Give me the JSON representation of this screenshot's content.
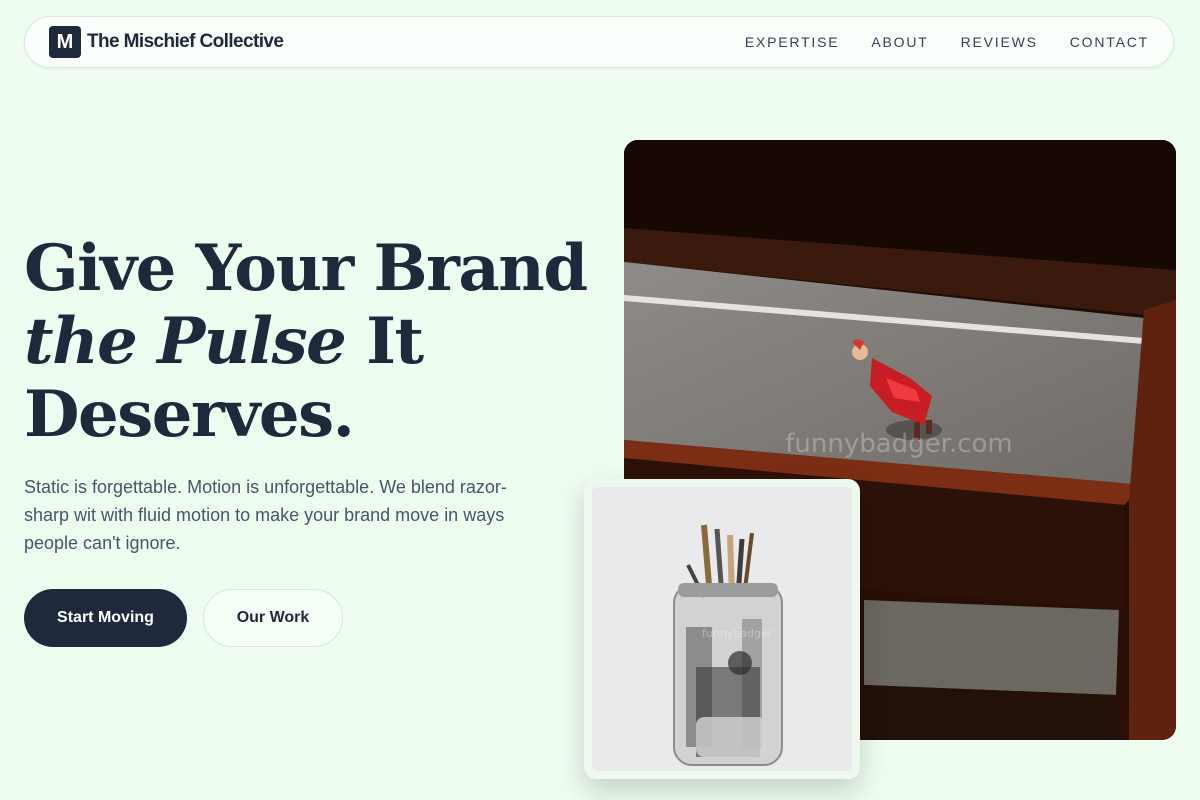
{
  "header": {
    "logo_letter": "M",
    "brand": "The Mischief Collective",
    "nav": [
      "EXPERTISE",
      "ABOUT",
      "REVIEWS",
      "CONTACT"
    ]
  },
  "hero": {
    "title_line1": "Give Your Brand",
    "title_italic": "the Pulse",
    "title_line2_rest": " It",
    "title_line3": "Deserves.",
    "subtitle": "Static is forgettable. Motion is unforgettable. We blend razor-sharp wit with fluid motion to make your brand move in ways people can't ignore.",
    "primary_cta": "Start Moving",
    "secondary_cta": "Our Work"
  },
  "images": {
    "main_watermark": "funnybadger.com",
    "card_watermark": "funnybadger"
  },
  "colors": {
    "background": "#effdf1",
    "primary": "#1e293b",
    "text_muted": "#475569"
  }
}
